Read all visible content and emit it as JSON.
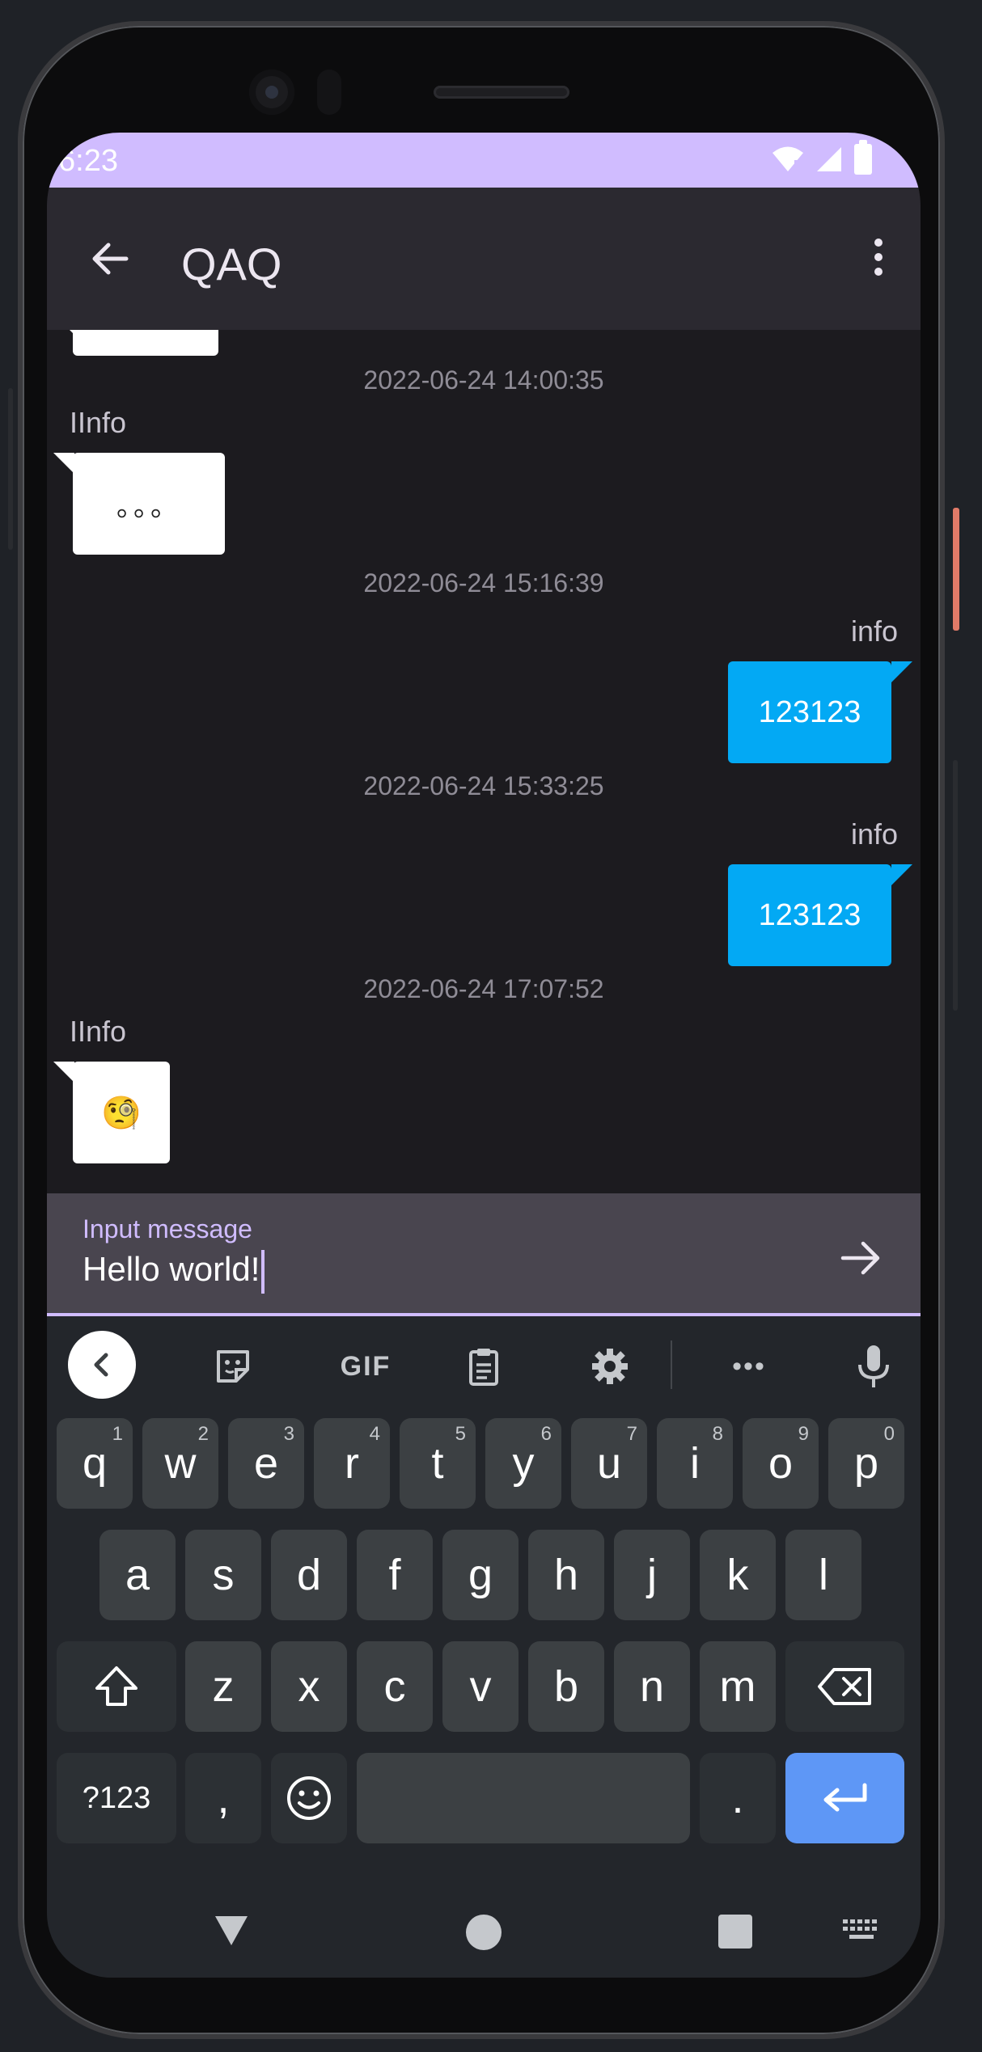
{
  "status_bar": {
    "time": "6:23"
  },
  "app_bar": {
    "title": "QAQ"
  },
  "messages": [
    {
      "timestamp": "2022-06-24 14:00:35",
      "sender": "IInfo",
      "direction": "incoming",
      "text": "。。。"
    },
    {
      "timestamp": "2022-06-24 15:16:39",
      "sender": "info",
      "direction": "outgoing",
      "text": "123123"
    },
    {
      "timestamp": "2022-06-24 15:33:25",
      "sender": "info",
      "direction": "outgoing",
      "text": "123123"
    },
    {
      "timestamp": "2022-06-24 17:07:52",
      "sender": "IInfo",
      "direction": "incoming",
      "text": "🧐"
    }
  ],
  "composer": {
    "label": "Input message",
    "value": "Hello world!"
  },
  "keyboard": {
    "toolbar": {
      "gif": "GIF",
      "more": "•••"
    },
    "row1": [
      {
        "key": "q",
        "hint": "1"
      },
      {
        "key": "w",
        "hint": "2"
      },
      {
        "key": "e",
        "hint": "3"
      },
      {
        "key": "r",
        "hint": "4"
      },
      {
        "key": "t",
        "hint": "5"
      },
      {
        "key": "y",
        "hint": "6"
      },
      {
        "key": "u",
        "hint": "7"
      },
      {
        "key": "i",
        "hint": "8"
      },
      {
        "key": "o",
        "hint": "9"
      },
      {
        "key": "p",
        "hint": "0"
      }
    ],
    "row2": [
      "a",
      "s",
      "d",
      "f",
      "g",
      "h",
      "j",
      "k",
      "l"
    ],
    "row3": [
      "z",
      "x",
      "c",
      "v",
      "b",
      "n",
      "m"
    ],
    "row4": {
      "symbols": "?123",
      "comma": ",",
      "period": "."
    }
  },
  "colors": {
    "accent": "#d0bcff",
    "outgoing_bubble": "#03a9f4",
    "incoming_bubble": "#ffffff",
    "enter_key": "#5e97f6"
  }
}
